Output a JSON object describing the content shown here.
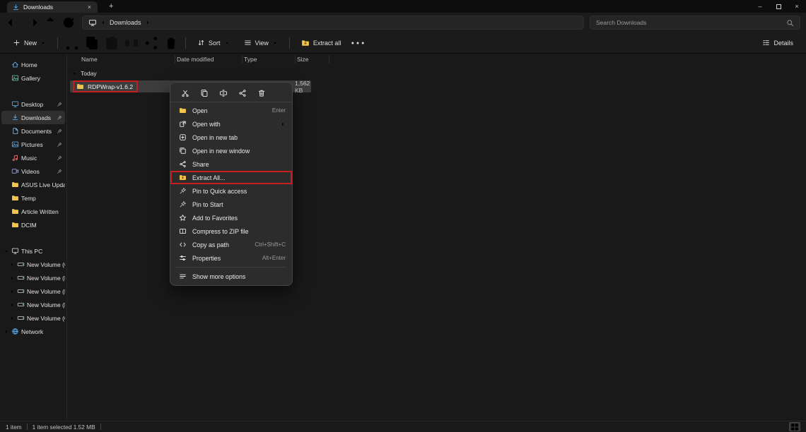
{
  "window": {
    "tab_title": "Downloads",
    "icons": {
      "close": "×",
      "minimize": "–",
      "plus": "+"
    }
  },
  "navbar": {
    "breadcrumb_item": "Downloads",
    "search_placeholder": "Search Downloads"
  },
  "toolbar": {
    "new_label": "New",
    "sort_label": "Sort",
    "view_label": "View",
    "extract_all_label": "Extract all",
    "details_label": "Details"
  },
  "columns": [
    "Name",
    "Date modified",
    "Type",
    "Size"
  ],
  "content": {
    "group_label": "Today",
    "file": {
      "name": "RDPWrap-v1.6.2",
      "size": "1,562 KB",
      "icon": "folder"
    }
  },
  "sidebar": [
    {
      "label": "Home",
      "icon": "home"
    },
    {
      "label": "Gallery",
      "icon": "gallery"
    },
    {
      "label": "Desktop",
      "icon": "desktop",
      "pinned": true,
      "gap_before": true
    },
    {
      "label": "Downloads",
      "icon": "download",
      "pinned": true,
      "selected": true
    },
    {
      "label": "Documents",
      "icon": "documents",
      "pinned": true
    },
    {
      "label": "Pictures",
      "icon": "pictures",
      "pinned": true
    },
    {
      "label": "Music",
      "icon": "music",
      "pinned": true
    },
    {
      "label": "Videos",
      "icon": "videos",
      "pinned": true
    },
    {
      "label": "ASUS Live Update",
      "icon": "folder"
    },
    {
      "label": "Temp",
      "icon": "folder"
    },
    {
      "label": "Article Written",
      "icon": "folder"
    },
    {
      "label": "DCIM",
      "icon": "folder"
    },
    {
      "label": "This PC",
      "icon": "pc",
      "expand": "down",
      "gap_before": true
    },
    {
      "label": "New Volume (C:)",
      "icon": "drive",
      "expand": "right",
      "indent": true
    },
    {
      "label": "New Volume (D:)",
      "icon": "drive",
      "expand": "right",
      "indent": true
    },
    {
      "label": "New Volume (E:)",
      "icon": "drive",
      "expand": "right",
      "indent": true
    },
    {
      "label": "New Volume (F:)",
      "icon": "drive",
      "expand": "right",
      "indent": true
    },
    {
      "label": "New Volume (G:)",
      "icon": "drive",
      "expand": "right",
      "indent": true
    },
    {
      "label": "Network",
      "icon": "network",
      "expand": "right"
    }
  ],
  "context_menu": {
    "quick_icons": [
      "cut",
      "copy",
      "rename",
      "share",
      "delete"
    ],
    "items": [
      {
        "label": "Open",
        "icon": "folder-open",
        "shortcut": "Enter"
      },
      {
        "label": "Open with",
        "icon": "open-with",
        "submenu": true
      },
      {
        "label": "Open in new tab",
        "icon": "new-tab"
      },
      {
        "label": "Open in new window",
        "icon": "new-window"
      },
      {
        "label": "Share",
        "icon": "share"
      },
      {
        "label": "Extract All...",
        "icon": "extract",
        "highlighted": true
      },
      {
        "label": "Pin to Quick access",
        "icon": "pin"
      },
      {
        "label": "Pin to Start",
        "icon": "pin"
      },
      {
        "label": "Add to Favorites",
        "icon": "star"
      },
      {
        "label": "Compress to ZIP file",
        "icon": "zip"
      },
      {
        "label": "Copy as path",
        "icon": "path",
        "shortcut": "Ctrl+Shift+C"
      },
      {
        "label": "Properties",
        "icon": "properties",
        "shortcut": "Alt+Enter"
      },
      {
        "label": "Show more options",
        "icon": "show-more",
        "separator_before": true
      }
    ]
  },
  "statusbar": {
    "items_count": "1 item",
    "selection": "1 item selected 1.52 MB"
  },
  "colors": {
    "highlight_red": "#c41f1f",
    "folder_yellow": "#f2c44d",
    "selection_gray": "#3d3d3d",
    "menu_bg": "#2c2c2c"
  }
}
